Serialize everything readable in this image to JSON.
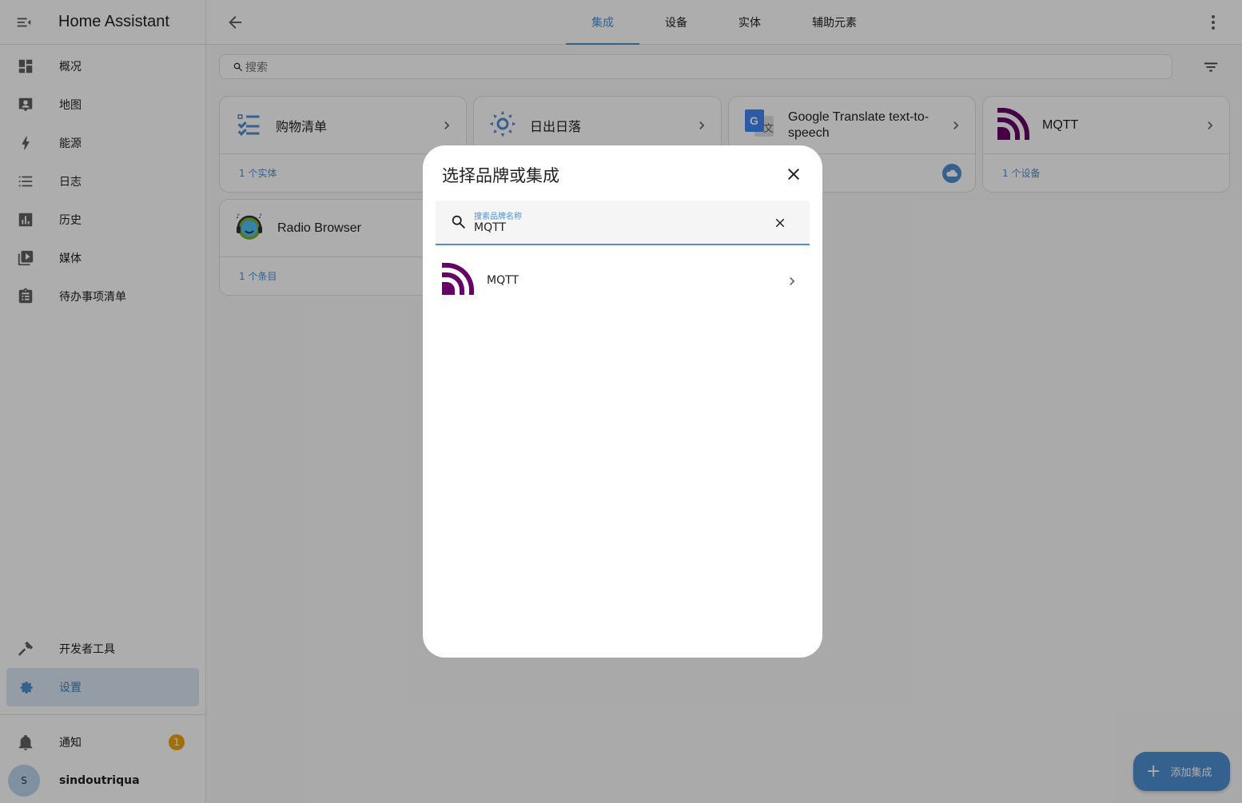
{
  "app": {
    "title": "Home Assistant"
  },
  "sidebar": {
    "items": [
      {
        "label": "概况",
        "icon": "dashboard-icon"
      },
      {
        "label": "地图",
        "icon": "map-account-icon"
      },
      {
        "label": "能源",
        "icon": "lightning-icon"
      },
      {
        "label": "日志",
        "icon": "list-icon"
      },
      {
        "label": "历史",
        "icon": "chart-box-icon"
      },
      {
        "label": "媒体",
        "icon": "play-box-multiple-icon"
      },
      {
        "label": "待办事项清单",
        "icon": "clipboard-list-icon"
      }
    ],
    "bottom": {
      "developer_tools": "开发者工具",
      "settings": "设置",
      "notifications": "通知",
      "notification_count": "1",
      "user_initial": "S",
      "user_name": "sindoutriqua"
    }
  },
  "header": {
    "tabs": [
      {
        "label": "集成",
        "active": true
      },
      {
        "label": "设备",
        "active": false
      },
      {
        "label": "实体",
        "active": false
      },
      {
        "label": "辅助元素",
        "active": false
      }
    ]
  },
  "search": {
    "placeholder": "搜索"
  },
  "cards": [
    {
      "name": "购物清单",
      "footer": "1 个实体"
    },
    {
      "name": "日出日落",
      "footer": ""
    },
    {
      "name": "Google Translate text-to-speech",
      "footer": ""
    },
    {
      "name": "MQTT",
      "footer": "1 个设备"
    },
    {
      "name": "Radio Browser",
      "footer": "1 个条目"
    }
  ],
  "dialog": {
    "title": "选择品牌或集成",
    "search_label": "搜索品牌名称",
    "search_value": "MQTT",
    "results": [
      {
        "name": "MQTT"
      }
    ]
  },
  "fab": {
    "label": "添加集成"
  },
  "colors": {
    "accent": "#4f8fd1",
    "mqtt": "#660066",
    "badge": "#f0a30a"
  }
}
